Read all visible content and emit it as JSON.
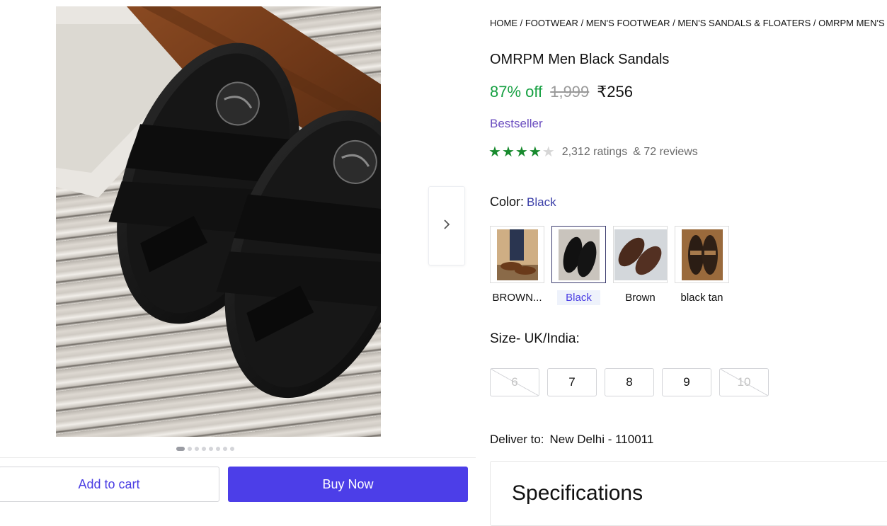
{
  "breadcrumb": [
    "HOME",
    "FOOTWEAR",
    "MEN'S FOOTWEAR",
    "MEN'S SANDALS & FLOATERS",
    "OMRPM MEN'S SAN"
  ],
  "product": {
    "title": "OMRPM Men Black Sandals",
    "discount": "87% off",
    "mrp": "1,999",
    "price": "₹256",
    "badge": "Bestseller",
    "rating_stars": 4,
    "ratings_text": "2,312 ratings",
    "reviews_text": "& 72 reviews"
  },
  "color": {
    "label": "Color:",
    "selected": "Black",
    "options": [
      {
        "label": "BROWN...",
        "selected": false
      },
      {
        "label": "Black",
        "selected": true
      },
      {
        "label": "Brown",
        "selected": false
      },
      {
        "label": "black tan",
        "selected": false
      }
    ]
  },
  "size": {
    "label": "Size- UK/India:",
    "options": [
      {
        "label": "6",
        "available": false
      },
      {
        "label": "7",
        "available": true
      },
      {
        "label": "8",
        "available": true
      },
      {
        "label": "9",
        "available": true
      },
      {
        "label": "10",
        "available": false
      }
    ]
  },
  "delivery": {
    "label": "Deliver to:",
    "location": "New Delhi - 110011"
  },
  "gallery": {
    "image_count": 8,
    "active_index": 0,
    "next_icon": "chevron-right-icon"
  },
  "actions": {
    "add_to_cart": "Add to cart",
    "buy_now": "Buy Now"
  },
  "specifications": {
    "title": "Specifications"
  },
  "colors": {
    "accent": "#4c3ee8",
    "discount": "#16a042",
    "star": "#188a2e",
    "badge": "#6c4fc0"
  }
}
